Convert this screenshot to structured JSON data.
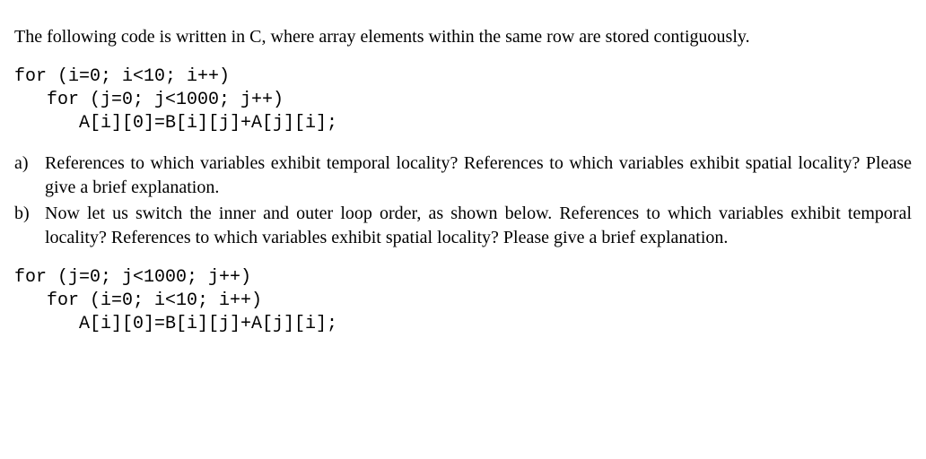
{
  "intro": "The following code is written in C, where array elements within the same row are stored contiguously.",
  "code1": {
    "line1": "for (i=0; i<10; i++)",
    "line2": "   for (j=0; j<1000; j++)",
    "line3": "      A[i][0]=B[i][j]+A[j][i];"
  },
  "questions": {
    "a": {
      "label": "a)",
      "text": "References to which variables exhibit temporal locality? References to which variables exhibit spatial locality? Please give a brief explanation."
    },
    "b": {
      "label": "b)",
      "text": "Now let us switch the inner and outer loop order, as shown below. References to which variables exhibit temporal locality? References to which variables exhibit spatial locality? Please give a brief explanation."
    }
  },
  "code2": {
    "line1": "for (j=0; j<1000; j++)",
    "line2": "   for (i=0; i<10; i++)",
    "line3": "      A[i][0]=B[i][j]+A[j][i];"
  }
}
